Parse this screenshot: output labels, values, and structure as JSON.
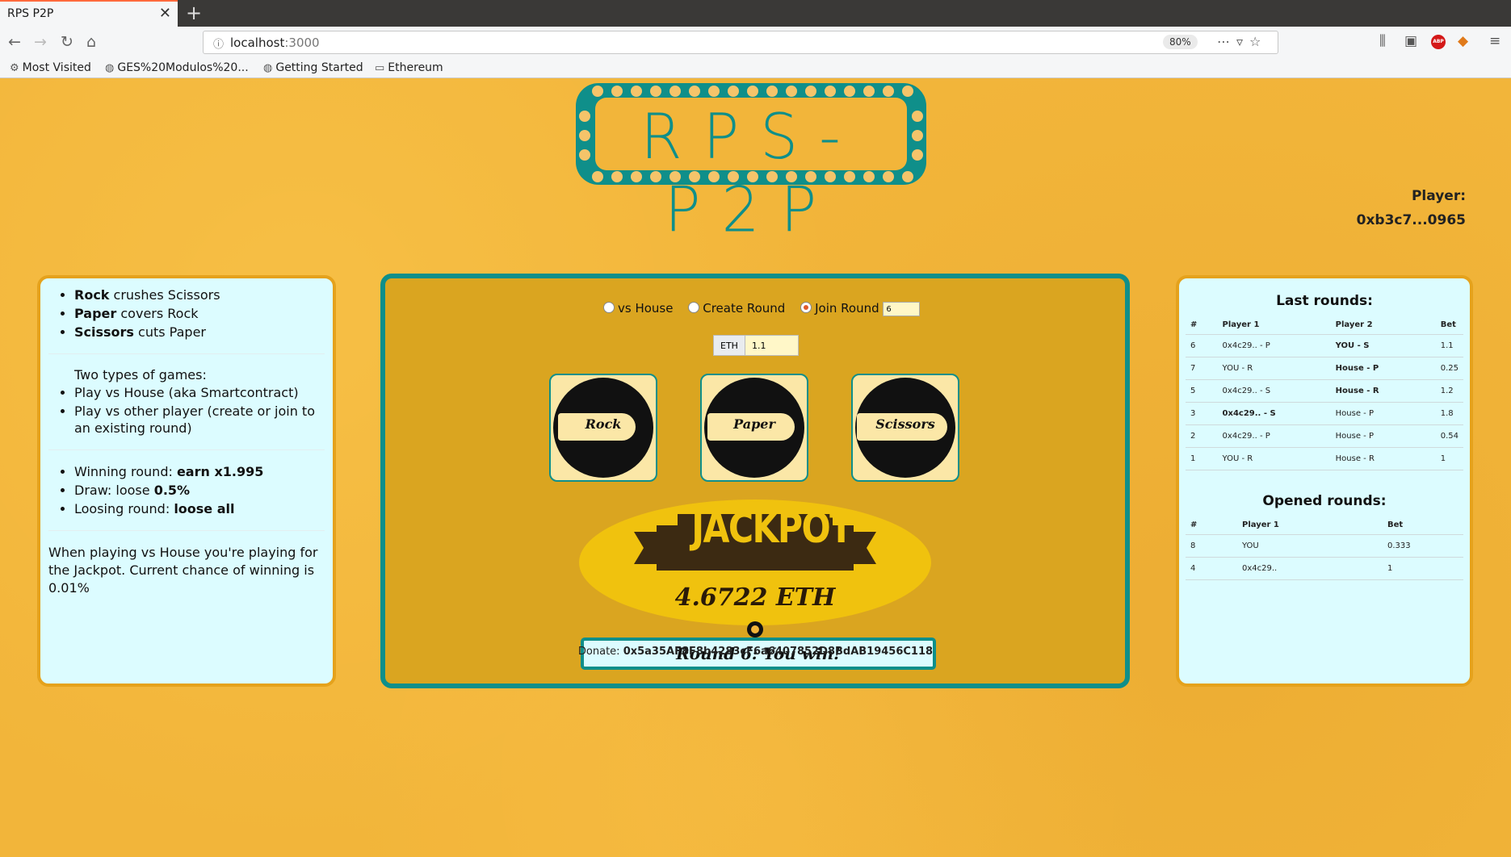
{
  "browser": {
    "tab_title": "RPS P2P",
    "url_host": "localhost",
    "url_port": ":3000",
    "zoom": "80%",
    "bookmarks": [
      "Most Visited",
      "GES%20Modulos%20...",
      "Getting Started",
      "Ethereum"
    ]
  },
  "header": {
    "logo_text": "RPS-P2P",
    "player_label": "Player:",
    "player_address": "0xb3c7...0965"
  },
  "rules": {
    "items": [
      {
        "bold": "Rock",
        "text": " crushes Scissors"
      },
      {
        "bold": "Paper",
        "text": " covers Rock"
      },
      {
        "bold": "Scissors",
        "text": " cuts Paper"
      }
    ],
    "game_types_title": "Two types of games:",
    "game_types": [
      "Play vs House (aka Smartcontract)",
      "Play vs other player (create or join to an existing round)"
    ],
    "payouts": [
      {
        "text": "Winning round: ",
        "bold": "earn x1.995"
      },
      {
        "text": "Draw: loose ",
        "bold": "0.5%"
      },
      {
        "text": "Loosing round: ",
        "bold": "loose all"
      }
    ],
    "jackpot_note": "When playing vs House you're playing for the Jackpot. Current chance of winning is 0.01%"
  },
  "game": {
    "modes": [
      "vs House",
      "Create Round",
      "Join Round"
    ],
    "selected_mode": "Join Round",
    "join_round_value": "6",
    "currency_label": "ETH",
    "bet_value": "1.1",
    "hands": [
      "Rock",
      "Paper",
      "Scissors"
    ],
    "jackpot_title": "JACKPOT",
    "jackpot_amount": "4.6722 ETH",
    "status": "Round 6: You win!"
  },
  "last_rounds": {
    "title": "Last rounds:",
    "headers": [
      "#",
      "Player 1",
      "Player 2",
      "Bet"
    ],
    "rows": [
      [
        "6",
        "0x4c29.. - P",
        "YOU - S",
        "1.1"
      ],
      [
        "7",
        "YOU - R",
        "House - P",
        "0.25"
      ],
      [
        "5",
        "0x4c29.. - S",
        "House - R",
        "1.2"
      ],
      [
        "3",
        "0x4c29.. - S",
        "House - P",
        "1.8"
      ],
      [
        "2",
        "0x4c29.. - P",
        "House - P",
        "0.54"
      ],
      [
        "1",
        "YOU - R",
        "House - R",
        "1"
      ]
    ]
  },
  "opened_rounds": {
    "title": "Opened rounds:",
    "headers": [
      "#",
      "Player 1",
      "Bet"
    ],
    "rows": [
      [
        "8",
        "YOU",
        "0.333"
      ],
      [
        "4",
        "0x4c29..",
        "1"
      ]
    ]
  },
  "footer": {
    "donate_label": "Donate: ",
    "donate_address": "0x5a35AF8F8b4283cF6a6407852D8BdAB19456C118"
  },
  "colors": {
    "teal": "#0f8f8a",
    "background": "#f2b53a",
    "panel": "#dcfcff",
    "game_bg": "#daa520"
  }
}
